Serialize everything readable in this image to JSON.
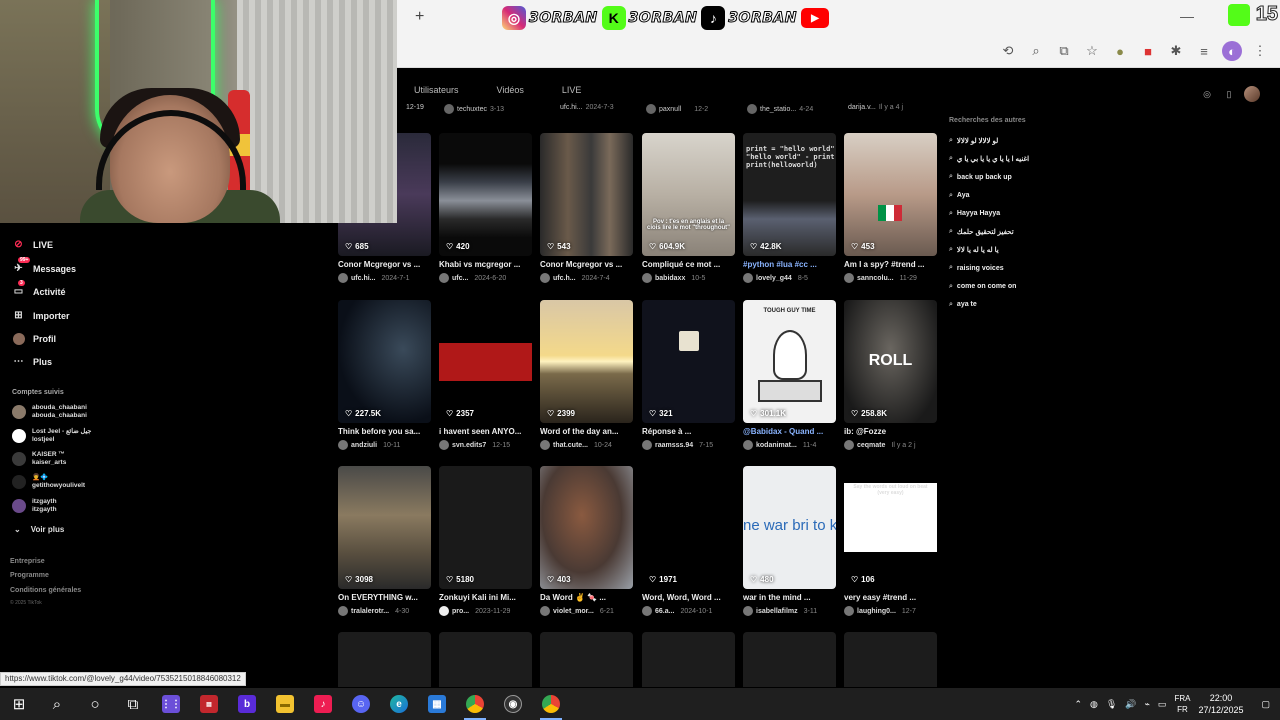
{
  "overlay": {
    "socials": [
      {
        "icon": "instagram-icon",
        "handle": "3ORBAN",
        "color": "#d6249f"
      },
      {
        "icon": "kick-icon",
        "handle": "3ORBAN",
        "color": "#53fc18"
      },
      {
        "icon": "tiktok-icon",
        "handle": "3ORBAN",
        "color": "#000000"
      }
    ],
    "corner_number": "15"
  },
  "browser": {
    "new_tab_glyph": "+",
    "minimize_glyph": "—"
  },
  "tiktok": {
    "tabs": [
      "Utilisateurs",
      "Vidéos",
      "LIVE"
    ],
    "nav": [
      {
        "label": "LIVE",
        "icon": "live-icon"
      },
      {
        "label": "Messages",
        "icon": "messages-icon",
        "badge": "99+"
      },
      {
        "label": "Activité",
        "icon": "activity-icon",
        "badge": "3"
      },
      {
        "label": "Importer",
        "icon": "upload-icon"
      },
      {
        "label": "Profil",
        "icon": "profile-icon"
      },
      {
        "label": "Plus",
        "icon": "more-icon"
      }
    ],
    "following_title": "Comptes suivis",
    "following": [
      {
        "name": "abouda_chaabani",
        "handle": "abouda_chaabani"
      },
      {
        "name": "Lost Jeel - جيل ضائع",
        "handle": "lostjeel"
      },
      {
        "name": "KAISER ™",
        "handle": "kaiser_arts"
      },
      {
        "name": "🧑‍🦱💠",
        "handle": "getithowyoulivelt"
      },
      {
        "name": "itzgayth",
        "handle": "itzgayth"
      }
    ],
    "see_more": "Voir plus",
    "footer": [
      "Entreprise",
      "Programme",
      "Conditions générales"
    ],
    "copyright": "© 2025 TikTok",
    "strip": [
      {
        "user": "",
        "date": "12-19"
      },
      {
        "user": "techuxtec",
        "date": "3-13"
      },
      {
        "user": "ufc.hi...",
        "date": "2024-7-3"
      },
      {
        "user": "paxnull",
        "date": "12-2"
      },
      {
        "user": "the_statio...",
        "date": "4-24"
      },
      {
        "user": "darija.v...",
        "date": "Il y a 4 j"
      }
    ],
    "videos": [
      {
        "likes": "685",
        "caption": "Conor Mcgregor vs ...",
        "user": "ufc.hi...",
        "date": "2024-7-1"
      },
      {
        "likes": "420",
        "caption": "Khabi vs mcgregor ...",
        "user": "ufc...",
        "date": "2024-6-20"
      },
      {
        "likes": "543",
        "caption": "Conor Mcgregor vs ...",
        "user": "ufc.h...",
        "date": "2024-7-4"
      },
      {
        "likes": "604.9K",
        "caption": "Compliqué ce mot ...",
        "user": "babidaxx",
        "date": "10-5",
        "overlay": "Pov : t'es en anglais et la ciois lire le mot \"throughout\""
      },
      {
        "likes": "42.8K",
        "caption": "#python #lua #cc ...",
        "user": "lovely_g44",
        "date": "8-5",
        "overlay": "print = \"hello world\"\n\"hello world\" - print\nprint(helloworld)"
      },
      {
        "likes": "453",
        "caption": "Am I a spy? #trend ...",
        "user": "sanncolu...",
        "date": "11-29"
      },
      {
        "likes": "227.5K",
        "caption": "Think before you sa...",
        "user": "andziuli",
        "date": "10-11"
      },
      {
        "likes": "2357",
        "caption": "i havent seen ANYO...",
        "user": "svn.edits7",
        "date": "12-15"
      },
      {
        "likes": "2399",
        "caption": "Word of the day an...",
        "user": "that.cute...",
        "date": "10-24"
      },
      {
        "likes": "321",
        "caption": "Réponse à ...",
        "user": "raamsss.94",
        "date": "7-15"
      },
      {
        "likes": "301.1K",
        "caption": "@Babidax - Quand ...",
        "user": "kodanimat...",
        "date": "11-4",
        "overlay": "TOUGH GUY TIME"
      },
      {
        "likes": "258.8K",
        "caption": "ib: @Fozze",
        "user": "ceqmate",
        "date": "Il y a 2 j",
        "overlay": "ROLL"
      },
      {
        "likes": "3098",
        "caption": "On EVERYTHING w...",
        "user": "tralalerotr...",
        "date": "4-30"
      },
      {
        "likes": "5180",
        "caption": "Zonkuyi Kali ini Mi...",
        "user": "pro...",
        "date": "2023-11-29"
      },
      {
        "likes": "403",
        "caption": "Da Word ✌ 🍬 ...",
        "user": "violet_mor...",
        "date": "6-21"
      },
      {
        "likes": "1971",
        "caption": "Word, Word, Word ...",
        "user": "66.a...",
        "date": "2024-10-1"
      },
      {
        "likes": "480",
        "caption": "war in the mind ...",
        "user": "isabellafilmz",
        "date": "3-11",
        "overlay": "ne war bri to keep a"
      },
      {
        "likes": "106",
        "caption": "very easy #trend ...",
        "user": "laughing0...",
        "date": "12-7",
        "overlay": "Say the words out loud on beat (very easy)"
      }
    ],
    "related_title": "Recherches des autres",
    "related": [
      "لو لالالا لو لالالا",
      "اغنيه ا يا يا ي يا يا بي يا ي",
      "back up back up",
      "Aya",
      "Hayya Hayya",
      "تحفيز لتحقيق حلمك",
      "يا له يا له يا لالا",
      "raising voices",
      "come on come on",
      "aya te"
    ]
  },
  "status_url": "https://www.tiktok.com/@lovely_g44/video/7535215018846080312",
  "taskbar": {
    "apps": [
      "windows-icon",
      "search-icon",
      "cortana-icon",
      "task-view-icon",
      "app-grid-icon",
      "voicemeeter-icon",
      "bing-icon",
      "file-explorer-icon",
      "tiktok-icon",
      "discord-icon",
      "edge-icon",
      "store-icon",
      "chrome-icon",
      "obs-icon",
      "chrome-icon"
    ],
    "lang_top": "FRA",
    "lang_bottom": "FR",
    "time": "22:00",
    "date": "27/12/2025"
  }
}
